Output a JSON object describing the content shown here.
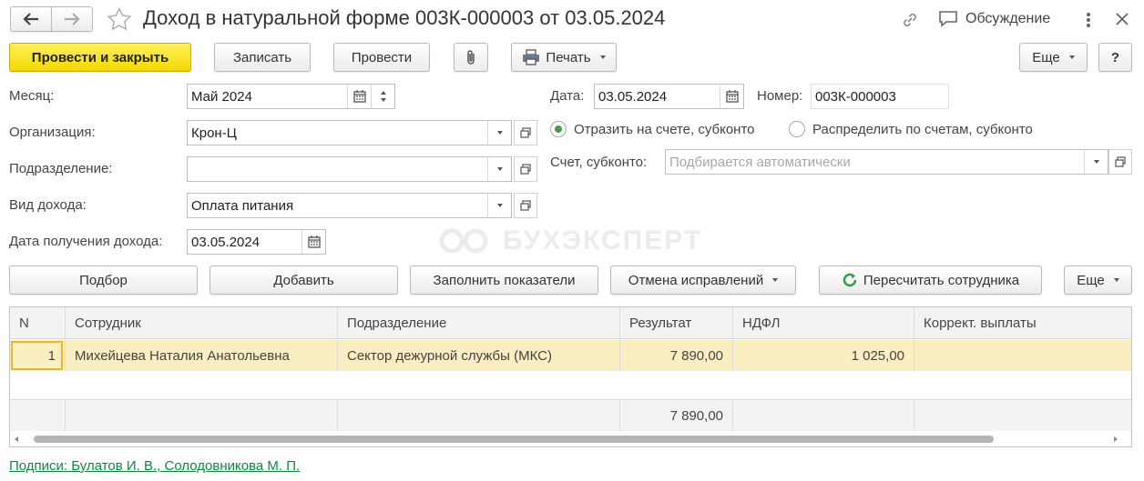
{
  "window": {
    "title": "Доход в натуральной форме 003К-000003 от 03.05.2024",
    "discussion_label": "Обсуждение"
  },
  "toolbar": {
    "post_close": "Провести и закрыть",
    "save": "Записать",
    "post": "Провести",
    "print": "Печать",
    "more": "Еще",
    "help": "?"
  },
  "form": {
    "month_label": "Месяц:",
    "month_value": "Май 2024",
    "org_label": "Организация:",
    "org_value": "Крон-Ц",
    "dept_label": "Подразделение:",
    "dept_value": "",
    "income_type_label": "Вид дохода:",
    "income_type_value": "Оплата питания",
    "income_date_label": "Дата получения дохода:",
    "income_date_value": "03.05.2024",
    "date_label": "Дата:",
    "date_value": "03.05.2024",
    "number_label": "Номер:",
    "number_value": "003К-000003",
    "radio_account": "Отразить на счете, субконто",
    "radio_distribute": "Распределить по счетам, субконто",
    "account_label": "Счет, субконто:",
    "account_placeholder": "Подбирается автоматически"
  },
  "watermark": "БУХЭКСПЕРТ",
  "table_toolbar": {
    "pick": "Подбор",
    "add": "Добавить",
    "fill": "Заполнить показатели",
    "cancel_fix": "Отмена исправлений",
    "recalc": "Пересчитать сотрудника",
    "more": "Еще"
  },
  "table": {
    "columns": [
      "N",
      "Сотрудник",
      "Подразделение",
      "Результат",
      "НДФЛ",
      "Коррект. выплаты"
    ],
    "rows": [
      {
        "n": "1",
        "employee": "Михейцева Наталия Анатольевна",
        "dept": "Сектор дежурной службы (МКС)",
        "result": "7 890,00",
        "ndfl": "1 025,00",
        "corr": ""
      }
    ],
    "total_result": "7 890,00"
  },
  "footer": {
    "signatures": "Подписи: Булатов И. В., Солодовникова М. П."
  }
}
